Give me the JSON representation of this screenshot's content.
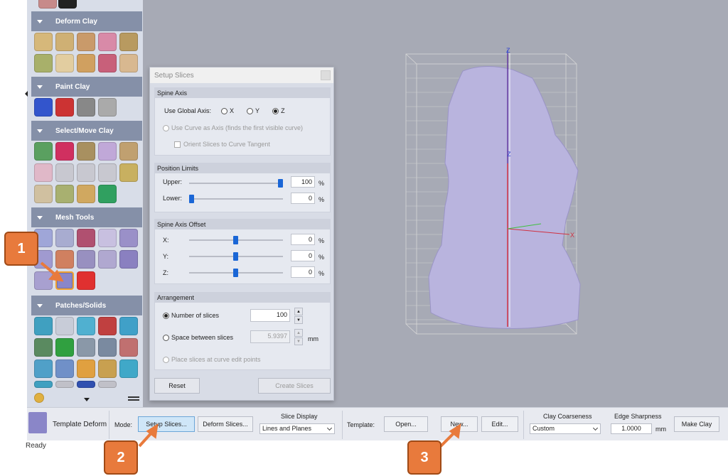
{
  "palette": {
    "sections": [
      {
        "label": "Deform Clay"
      },
      {
        "label": "Paint Clay"
      },
      {
        "label": "Select/Move Clay"
      },
      {
        "label": "Mesh Tools"
      },
      {
        "label": "Patches/Solids"
      }
    ]
  },
  "dialog": {
    "title": "Setup Slices",
    "spine_axis": {
      "header": "Spine Axis",
      "global_axis_label": "Use Global Axis:",
      "axis_x": "X",
      "axis_y": "Y",
      "axis_z": "Z",
      "selected": "Z",
      "use_curve_label": "Use Curve as Axis  (finds the first visible curve)",
      "orient_label": "Orient Slices to Curve Tangent"
    },
    "position_limits": {
      "header": "Position Limits",
      "upper_label": "Upper:",
      "upper_value": "100",
      "upper_unit": "%",
      "lower_label": "Lower:",
      "lower_value": "0",
      "lower_unit": "%",
      "upper_fraction": 1.0,
      "lower_fraction": 0.0
    },
    "spine_offset": {
      "header": "Spine Axis Offset",
      "x_label": "X:",
      "x_value": "0",
      "y_label": "Y:",
      "y_value": "0",
      "z_label": "Z:",
      "z_value": "0",
      "unit": "%"
    },
    "arrangement": {
      "header": "Arrangement",
      "num_slices_label": "Number of slices",
      "num_slices_value": "100",
      "space_label": "Space between slices",
      "space_value": "5.9397",
      "space_unit": "mm",
      "curve_points_label": "Place slices at curve edit points"
    },
    "reset_label": "Reset",
    "create_label": "Create Slices"
  },
  "bottombar": {
    "tool_name": "Template Deform",
    "mode_label": "Mode:",
    "setup_slices_btn": "Setup Slices...",
    "deform_slices_btn": "Deform Slices...",
    "slice_display_label": "Slice Display",
    "slice_display_value": "Lines and Planes",
    "template_label": "Template:",
    "open_btn": "Open...",
    "new_btn": "New...",
    "edit_btn": "Edit...",
    "clay_coarseness_label": "Clay Coarseness",
    "clay_coarseness_value": "Custom",
    "edge_sharpness_label": "Edge Sharpness",
    "edge_sharpness_value": "1.0000",
    "edge_sharpness_unit": "mm",
    "make_clay_btn": "Make Clay"
  },
  "status": "Ready",
  "viewport": {
    "axis_z": "Z",
    "axis_x": "X"
  },
  "callouts": {
    "one": "1",
    "two": "2",
    "three": "3"
  },
  "colors": {
    "accent": "#1a66d6",
    "callout": "#e87a3c",
    "section": "#8590a8",
    "clay": "#b9b4de"
  }
}
